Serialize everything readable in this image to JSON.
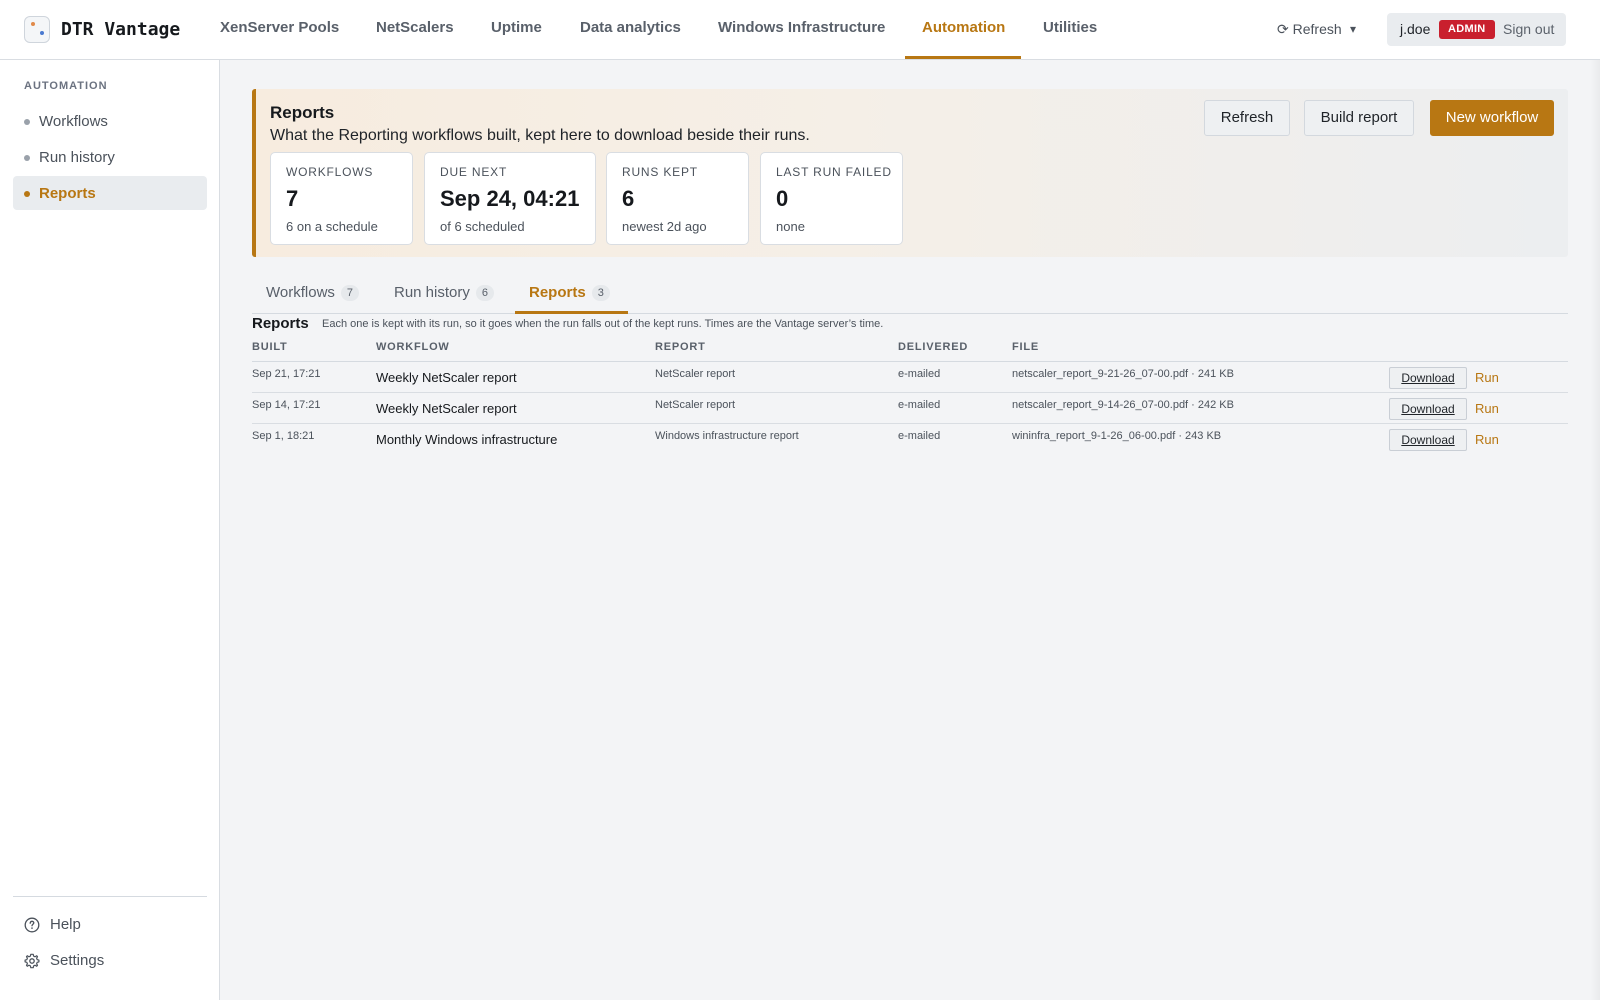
{
  "app": {
    "name": "DTR Vantage"
  },
  "nav": {
    "items": [
      {
        "label": "XenServer Pools"
      },
      {
        "label": "NetScalers"
      },
      {
        "label": "Uptime"
      },
      {
        "label": "Data analytics"
      },
      {
        "label": "Windows Infrastructure"
      },
      {
        "label": "Automation",
        "active": true
      },
      {
        "label": "Utilities"
      }
    ],
    "refresh_label": "⟳ Refresh",
    "caret": "▾"
  },
  "user": {
    "name": "j.doe",
    "role_badge": "ADMIN",
    "signout_label": "Sign out"
  },
  "sidebar": {
    "heading": "AUTOMATION",
    "items": [
      {
        "label": "Workflows"
      },
      {
        "label": "Run history"
      },
      {
        "label": "Reports",
        "active": true
      }
    ],
    "bottom": [
      {
        "label": "Help",
        "icon": "help-circle-icon"
      },
      {
        "label": "Settings",
        "icon": "gear-icon"
      }
    ]
  },
  "hero": {
    "title": "Reports",
    "subtitle": "What the Reporting workflows built, kept here to download beside their runs.",
    "buttons": {
      "refresh": "Refresh",
      "build": "Build report",
      "new": "New workflow"
    },
    "stats": [
      {
        "label": "WORKFLOWS",
        "value": "7",
        "note": "6 on a schedule"
      },
      {
        "label": "DUE NEXT",
        "value": "Sep 24, 04:21",
        "note": "of 6 scheduled"
      },
      {
        "label": "RUNS KEPT",
        "value": "6",
        "note": "newest 2d ago"
      },
      {
        "label": "LAST RUN FAILED",
        "value": "0",
        "note": "none"
      }
    ]
  },
  "tabs": [
    {
      "label": "Workflows",
      "count": "7"
    },
    {
      "label": "Run history",
      "count": "6"
    },
    {
      "label": "Reports",
      "count": "3",
      "active": true
    }
  ],
  "reports": {
    "title": "Reports",
    "note": "Each one is kept with its run, so it goes when the run falls out of the kept runs. Times are the Vantage server’s time.",
    "columns": {
      "built": "BUILT",
      "workflow": "WORKFLOW",
      "report": "REPORT",
      "delivered": "DELIVERED",
      "file": "FILE"
    },
    "download_label": "Download",
    "run_label": "Run",
    "rows": [
      {
        "built": "Sep 21, 17:21",
        "workflow": "Weekly NetScaler report",
        "report": "NetScaler report",
        "delivered": "e-mailed",
        "file": "netscaler_report_9-21-26_07-00.pdf · 241 KB"
      },
      {
        "built": "Sep 14, 17:21",
        "workflow": "Weekly NetScaler report",
        "report": "NetScaler report",
        "delivered": "e-mailed",
        "file": "netscaler_report_9-14-26_07-00.pdf · 242 KB"
      },
      {
        "built": "Sep 1, 18:21",
        "workflow": "Monthly Windows infrastructure",
        "report": "Windows infrastructure report",
        "delivered": "e-mailed",
        "file": "wininfra_report_9-1-26_06-00.pdf · 243 KB"
      }
    ]
  },
  "colors": {
    "accent": "#b87713",
    "badge": "#c9202e"
  }
}
